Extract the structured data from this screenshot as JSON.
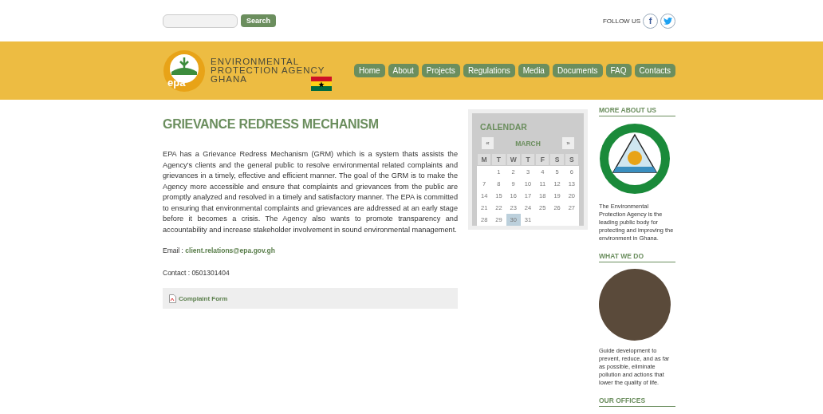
{
  "top_bar": {
    "search": {
      "button": "Search"
    },
    "follow_label": "FOLLOW US",
    "social": [
      {
        "kind": "facebook",
        "label": "f"
      },
      {
        "kind": "twitter"
      }
    ]
  },
  "header": {
    "logo_text": "epa",
    "agency_lines": [
      "ENVIRONMENTAL",
      "PROTECTION AGENCY",
      "GHANA"
    ],
    "nav": [
      {
        "label": "Home"
      },
      {
        "label": "About"
      },
      {
        "label": "Projects"
      },
      {
        "label": "Regulations"
      },
      {
        "label": "Media"
      },
      {
        "label": "Documents"
      },
      {
        "label": "FAQ"
      },
      {
        "label": "Contacts"
      }
    ]
  },
  "article": {
    "title": "GRIEVANCE REDRESS MECHANISM",
    "body": "EPA has a Grievance Redress Mechanism (GRM) which is a system thats assists the Agency's clients and the general public to resolve environmental related complaints and grievances in a timely, effective and efficient manner. The goal of the GRM is to make the Agency more accessible and ensure that complaints and grievances from the public are promptly analyzed and resolved in a timely and satisfactory manner. The EPA is committed to ensuring that environmental complaints and grievances are addressed at an early stage before it becomes a crisis. The Agency also wants to promote transparency and accountability and increase stakeholder involvement in sound environmental management.",
    "email_label": "Email : ",
    "email": "client.relations@epa.gov.gh",
    "contact": "Contact : 0501301404",
    "attachment": "Complaint Form"
  },
  "calendar": {
    "title": "CALENDAR",
    "prev": "«",
    "month": "MARCH",
    "next": "»",
    "weekdays": [
      "M",
      "T",
      "W",
      "T",
      "F",
      "S",
      "S"
    ],
    "days": [
      {
        "label": "1",
        "selected": false
      },
      {
        "label": "2",
        "selected": false
      },
      {
        "label": "3",
        "selected": false
      },
      {
        "label": "4",
        "selected": false
      },
      {
        "label": "5",
        "selected": false
      },
      {
        "label": "6",
        "selected": false
      },
      {
        "label": "7",
        "selected": false
      },
      {
        "label": "8",
        "selected": false
      },
      {
        "label": "9",
        "selected": false
      },
      {
        "label": "10",
        "selected": false
      },
      {
        "label": "11",
        "selected": false
      },
      {
        "label": "12",
        "selected": false
      },
      {
        "label": "13",
        "selected": false
      },
      {
        "label": "14",
        "selected": false
      },
      {
        "label": "15",
        "selected": false
      },
      {
        "label": "16",
        "selected": false
      },
      {
        "label": "17",
        "selected": false
      },
      {
        "label": "18",
        "selected": false
      },
      {
        "label": "19",
        "selected": false
      },
      {
        "label": "20",
        "selected": false
      },
      {
        "label": "21",
        "selected": false
      },
      {
        "label": "22",
        "selected": false
      },
      {
        "label": "23",
        "selected": false
      },
      {
        "label": "24",
        "selected": false
      },
      {
        "label": "25",
        "selected": false
      },
      {
        "label": "26",
        "selected": false
      },
      {
        "label": "27",
        "selected": false
      },
      {
        "label": "28",
        "selected": false
      },
      {
        "label": "29",
        "selected": false
      },
      {
        "label": "30",
        "selected": true
      },
      {
        "label": "31",
        "selected": false
      }
    ]
  },
  "sidebar": [
    {
      "heading": "MORE ABOUT US",
      "kind": "emblem",
      "text": "The Environmental Protection Agency is the leading public body for protecting and improving the environment in Ghana."
    },
    {
      "heading": "WHAT WE DO",
      "kind": "photo",
      "text": "Guide development to prevent, reduce, and as far as possible, eliminate pollution and actions that lower the quality of life."
    },
    {
      "heading": "OUR OFFICES"
    }
  ]
}
